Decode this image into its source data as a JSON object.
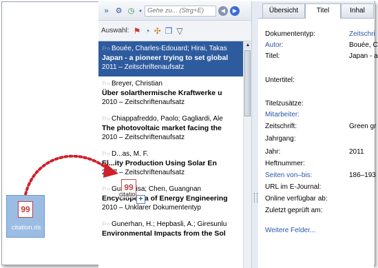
{
  "toolbar": {
    "goto_placeholder": "Gehe zu... (Strg+E)"
  },
  "selection": {
    "label": "Auswahl:"
  },
  "results": [
    {
      "authors": "Bouée, Charles-Edouard; Hirai, Takas",
      "title": "Japan - a pioneer trying to set global",
      "meta": "2011 – Zeitschriftenaufsatz",
      "selected": true
    },
    {
      "authors": "Breyer, Christian",
      "title": "Über solarthermische Kraftwerke u",
      "meta": "2010 – Zeitschriftenaufsatz",
      "selected": false
    },
    {
      "authors": "Chiappafreddo, Paolo; Gagliardi, Ale",
      "title": "The photovoltaic market facing the",
      "meta": "2010 – Zeitschriftenaufsatz",
      "selected": false
    },
    {
      "authors": "D...as, M. F.",
      "title": "El...ity Production Using Solar En",
      "meta": "2007 – Zeitschriftenaufsatz",
      "selected": false
    },
    {
      "authors": "Guan, Lisa; Chen, Guangnan",
      "title": "Encyclopedia of Energy Engineering",
      "meta": "2010 – Unklarer Dokumententyp",
      "selected": false
    },
    {
      "authors": "Gunerhan, H.; Hepbasli, A.; Giresunlu",
      "title": "Environmental Impacts from the Sol",
      "meta": "",
      "selected": false
    }
  ],
  "tabs": [
    {
      "label": "Übersicht"
    },
    {
      "label": "Titel"
    },
    {
      "label": "Inhal"
    }
  ],
  "detail": {
    "dokumententyp": {
      "label": "Dokumententyp:",
      "value": "Zeitschri"
    },
    "autor": {
      "label": "Autor:",
      "value": "Bouée, C"
    },
    "titel": {
      "label": "Titel:",
      "value": "Japan - a"
    },
    "untertitel": {
      "label": "Untertitel:"
    },
    "titelzusaetze": {
      "label": "Titelzusätze:"
    },
    "mitarbeiter": {
      "label": "Mitarbeiter:"
    },
    "zeitschrift": {
      "label": "Zeitschrift:",
      "value": "Green gr"
    },
    "jahrgang": {
      "label": "Jahrgang:"
    },
    "jahr": {
      "label": "Jahr:",
      "value": "2011"
    },
    "heftnummer": {
      "label": "Heftnummer:"
    },
    "seiten": {
      "label": "Seiten von–bis:",
      "value": "186–193"
    },
    "url": {
      "label": "URL im E-Journal:"
    },
    "online": {
      "label": "Online verfügbar ab:"
    },
    "zuletzt": {
      "label": "Zuletzt geprüft am:"
    },
    "weitere": {
      "label": "Weitere Felder..."
    }
  },
  "drag": {
    "file_name": "citation.ris",
    "ghost_label": "citatio",
    "file_glyph": "99",
    "plus_glyph": "+"
  },
  "colors": {
    "selection": "#2d5b9e",
    "accent_blue": "#2a56a6",
    "drag_red": "#d0202a"
  }
}
